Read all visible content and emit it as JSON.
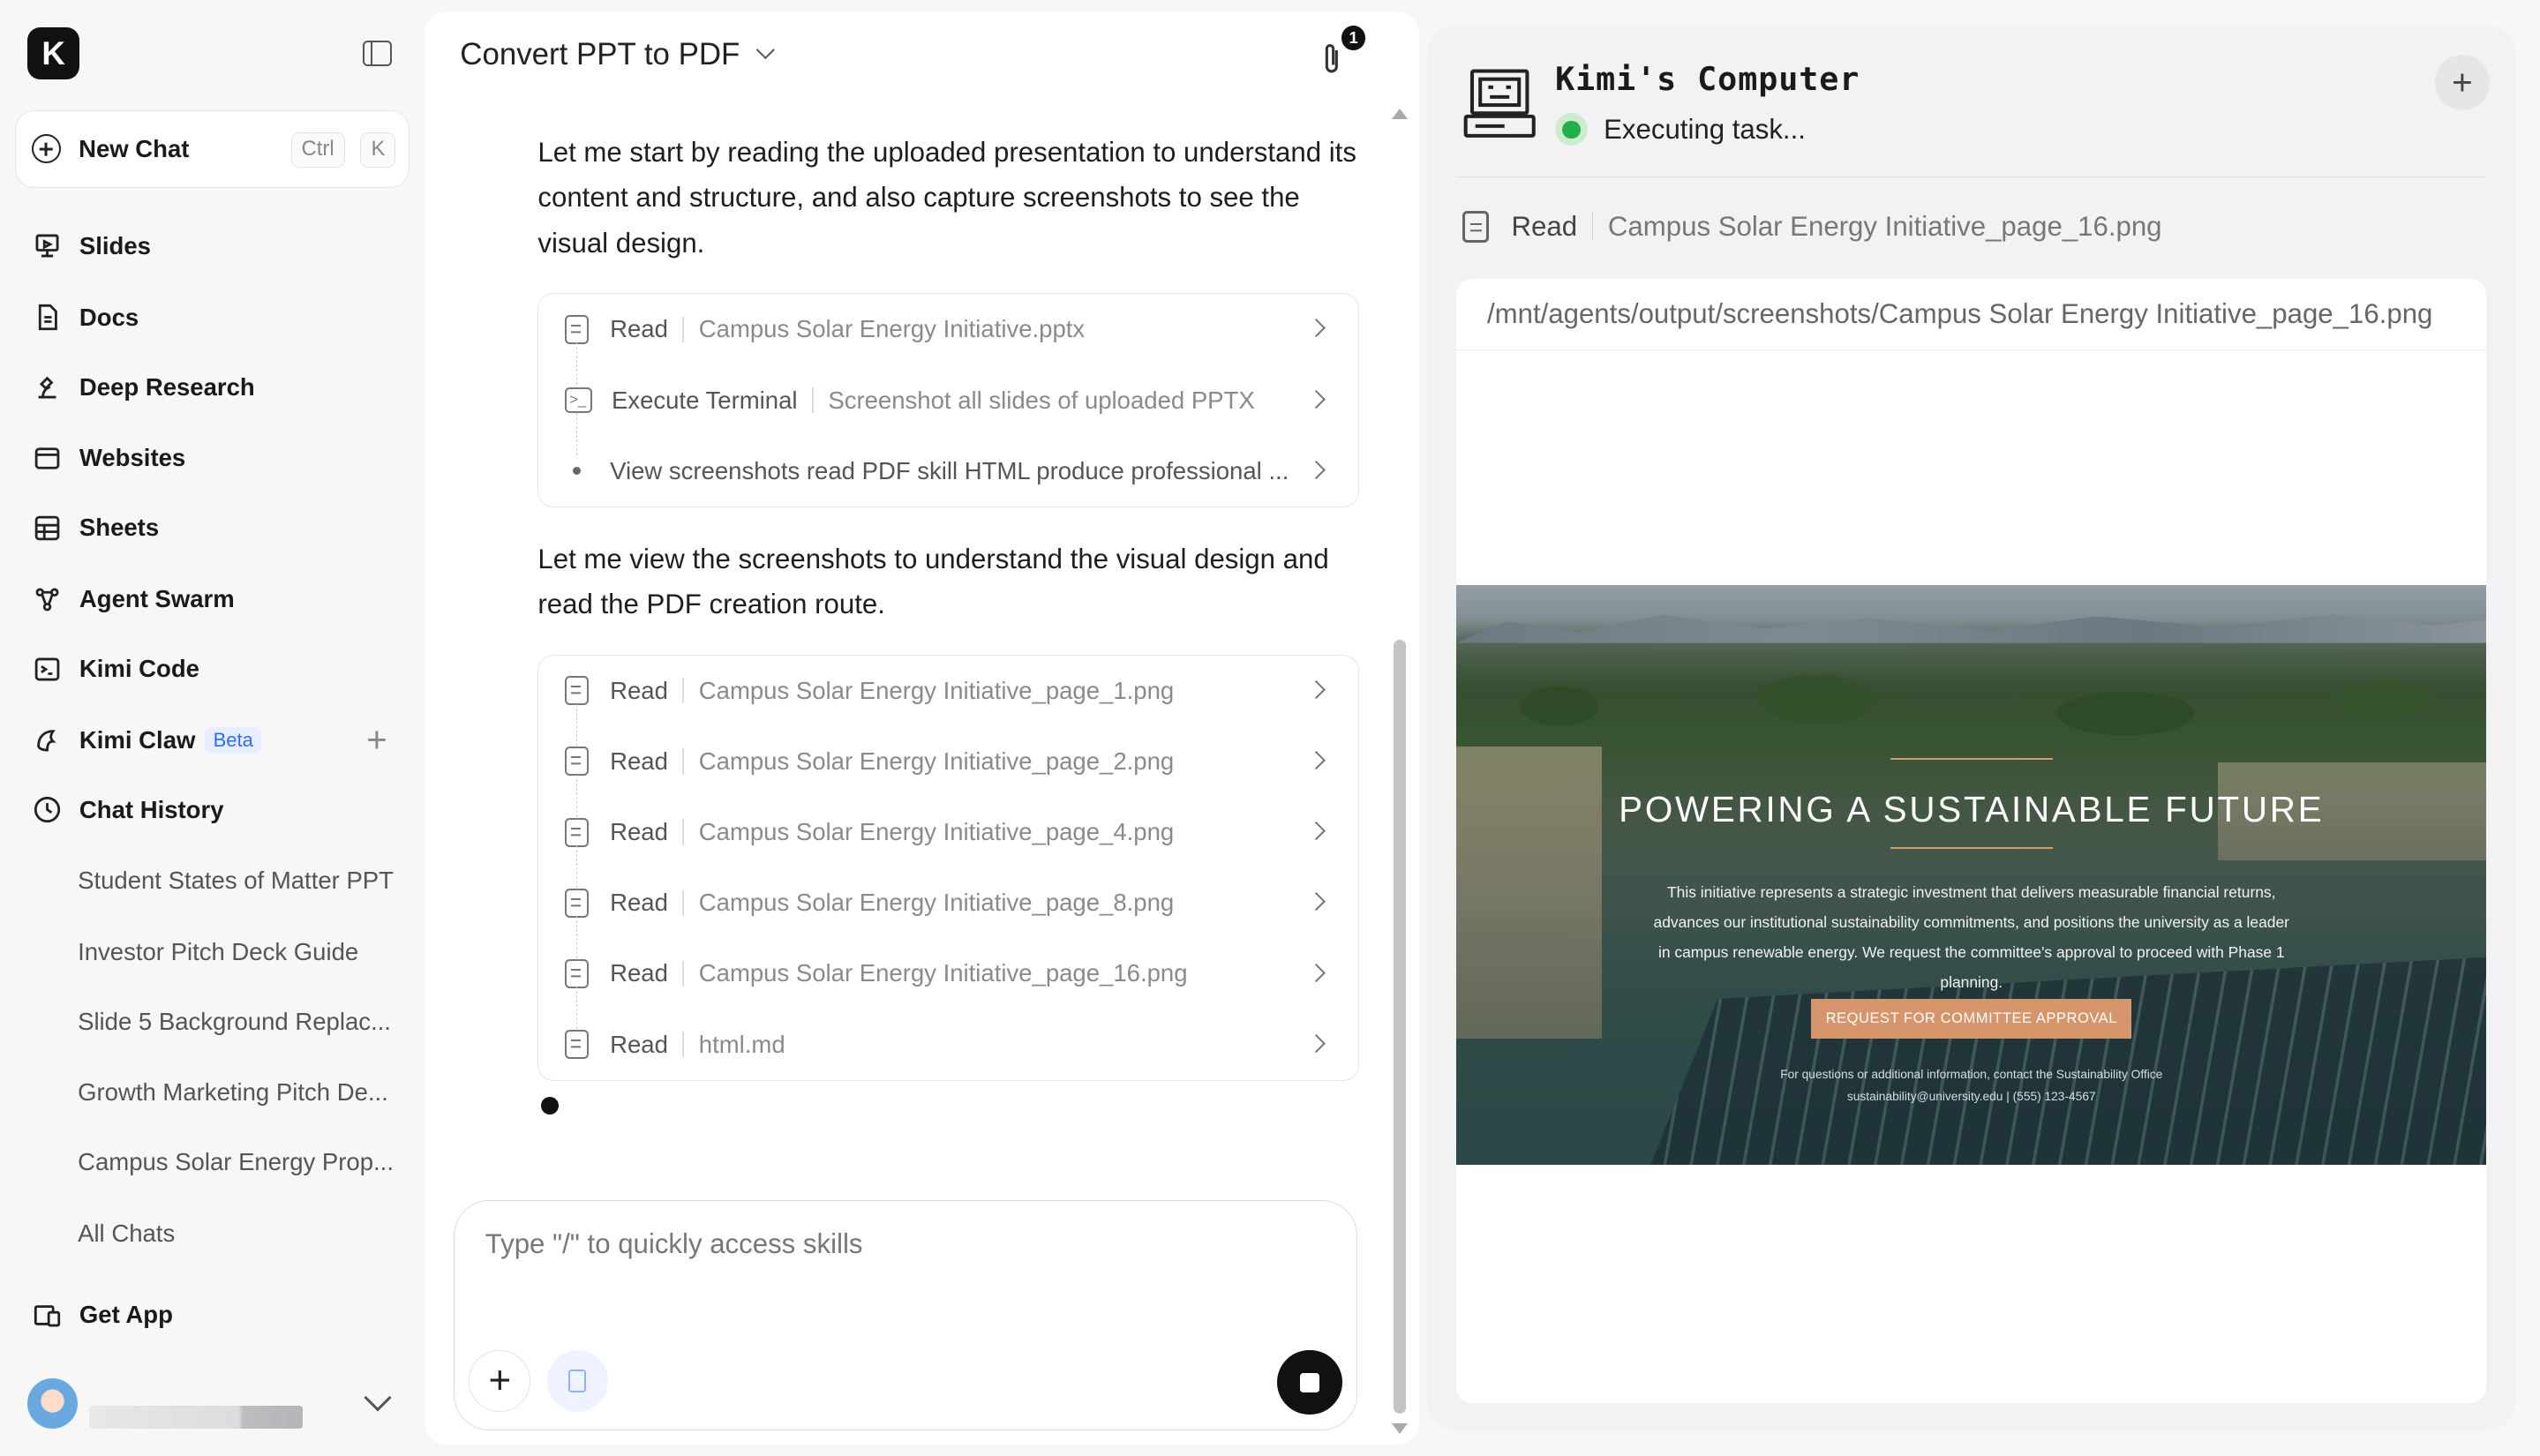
{
  "sidebar": {
    "logo": "K",
    "new_chat": {
      "label": "New Chat",
      "shortcut_ctrl": "Ctrl",
      "shortcut_key": "K"
    },
    "nav": [
      {
        "label": "Slides",
        "icon": "slides-icon"
      },
      {
        "label": "Docs",
        "icon": "docs-icon"
      },
      {
        "label": "Deep Research",
        "icon": "deep-research-icon"
      },
      {
        "label": "Websites",
        "icon": "websites-icon"
      },
      {
        "label": "Sheets",
        "icon": "sheets-icon"
      },
      {
        "label": "Agent Swarm",
        "icon": "agent-swarm-icon"
      },
      {
        "label": "Kimi Code",
        "icon": "terminal-icon"
      },
      {
        "label": "Kimi Claw",
        "icon": "claw-icon",
        "badge": "Beta"
      },
      {
        "label": "Chat History",
        "icon": "clock-icon"
      }
    ],
    "history": [
      "Student States of Matter PPT",
      "Investor Pitch Deck Guide",
      "Slide 5 Background Replac...",
      "Growth Marketing Pitch De...",
      "Campus Solar Energy Prop...",
      "All Chats"
    ],
    "get_app": "Get App"
  },
  "chat": {
    "title": "Convert PPT to PDF",
    "attachment_count": "1",
    "para1": "Let me start by reading the uploaded presentation to understand its content and structure, and also capture screenshots to see the visual design.",
    "tools1": [
      {
        "action": "Read",
        "arg": "Campus Solar Energy Initiative.pptx",
        "icon": "file-icon"
      },
      {
        "action": "Execute Terminal",
        "arg": "Screenshot all slides of uploaded PPTX",
        "icon": "terminal-icon"
      },
      {
        "action": "View screenshots read PDF skill HTML produce professional ...",
        "arg": "",
        "icon": "dot-icon"
      }
    ],
    "para2": "Let me view the screenshots to understand the visual design and read the PDF creation route.",
    "tools2": [
      {
        "action": "Read",
        "arg": "Campus Solar Energy Initiative_page_1.png"
      },
      {
        "action": "Read",
        "arg": "Campus Solar Energy Initiative_page_2.png"
      },
      {
        "action": "Read",
        "arg": "Campus Solar Energy Initiative_page_4.png"
      },
      {
        "action": "Read",
        "arg": "Campus Solar Energy Initiative_page_8.png"
      },
      {
        "action": "Read",
        "arg": "Campus Solar Energy Initiative_page_16.png"
      },
      {
        "action": "Read",
        "arg": "html.md"
      }
    ],
    "input_placeholder": "Type \"/\" to quickly access skills"
  },
  "computer": {
    "title": "Kimi's Computer",
    "status": "Executing task...",
    "status_color": "#22b04b",
    "current_action": "Read",
    "current_arg": "Campus Solar Energy Initiative_page_16.png",
    "path": "/mnt/agents/output/screenshots/Campus Solar Energy Initiative_page_16.png",
    "slide": {
      "title": "POWERING A SUSTAINABLE FUTURE",
      "body": "This initiative represents a strategic investment that delivers measurable financial returns, advances our institutional sustainability commitments, and positions the university as a leader in campus renewable energy. We request the committee's approval to proceed with Phase 1 planning.",
      "button": "REQUEST FOR COMMITTEE APPROVAL",
      "footer1": "For questions or additional information, contact the Sustainability Office",
      "footer2": "sustainability@university.edu | (555) 123-4567",
      "accent": "#d6956a"
    }
  }
}
